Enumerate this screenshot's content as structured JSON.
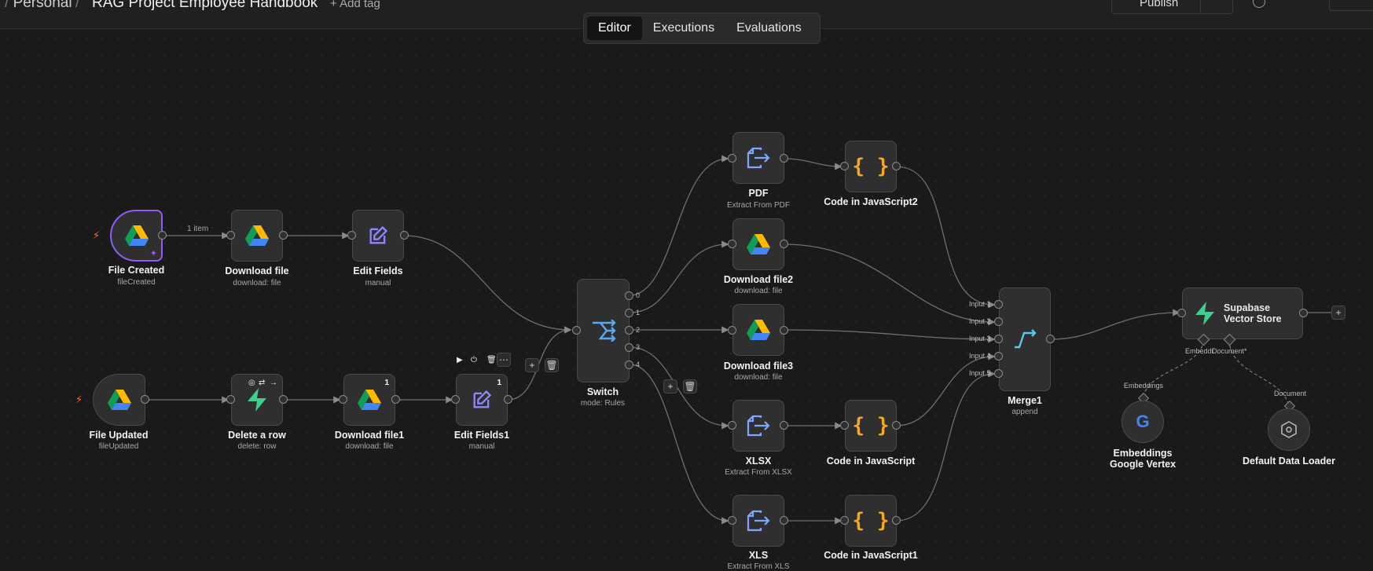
{
  "header": {
    "breadcrumb_personal": "Personal",
    "workflow_name": "RAG Project Employee Handbook",
    "add_tag": "+ Add tag",
    "publish": "Publish"
  },
  "tabs": [
    {
      "label": "Editor",
      "active": true
    },
    {
      "label": "Executions"
    },
    {
      "label": "Evaluations"
    }
  ],
  "edge_labels": {
    "item_count": "1 item"
  },
  "nodes": {
    "file_created": {
      "title": "File Created",
      "sub": "fileCreated",
      "icon": "google-drive-icon"
    },
    "download_file": {
      "title": "Download file",
      "sub": "download: file",
      "icon": "google-drive-icon"
    },
    "edit_fields": {
      "title": "Edit Fields",
      "sub": "manual",
      "icon": "pencil-icon"
    },
    "file_updated": {
      "title": "File Updated",
      "sub": "fileUpdated",
      "icon": "google-drive-icon"
    },
    "delete_row": {
      "title": "Delete a row",
      "sub": "delete: row",
      "icon": "supabase-icon"
    },
    "download_file1": {
      "title": "Download file1",
      "sub": "download: file",
      "icon": "google-drive-icon",
      "badge": "1"
    },
    "edit_fields1": {
      "title": "Edit Fields1",
      "sub": "manual",
      "icon": "pencil-icon",
      "badge": "1"
    },
    "switch": {
      "title": "Switch",
      "sub": "mode: Rules",
      "icon": "switch-icon",
      "outputs": [
        "0",
        "1",
        "2",
        "3",
        "4"
      ]
    },
    "pdf": {
      "title": "PDF",
      "sub": "Extract From PDF",
      "icon": "extract-icon"
    },
    "download_file2": {
      "title": "Download file2",
      "sub": "download: file",
      "icon": "google-drive-icon"
    },
    "download_file3": {
      "title": "Download file3",
      "sub": "download: file",
      "icon": "google-drive-icon"
    },
    "xlsx": {
      "title": "XLSX",
      "sub": "Extract From XLSX",
      "icon": "extract-icon"
    },
    "xls": {
      "title": "XLS",
      "sub": "Extract From XLS",
      "icon": "extract-icon"
    },
    "code2": {
      "title": "Code in JavaScript2",
      "icon": "code-braces-icon"
    },
    "code": {
      "title": "Code in JavaScript",
      "icon": "code-braces-icon"
    },
    "code1": {
      "title": "Code in JavaScript1",
      "icon": "code-braces-icon"
    },
    "merge1": {
      "title": "Merge1",
      "sub": "append",
      "icon": "merge-icon",
      "inputs": [
        "Input 1",
        "Input 2",
        "Input 3",
        "Input 4",
        "Input 5"
      ]
    },
    "supabase_store": {
      "title": "Supabase Vector Store",
      "icon": "supabase-icon",
      "ports": [
        "Embeddi",
        "Document*"
      ]
    },
    "embeddings": {
      "title": "Embeddings Google Vertex",
      "icon": "google-icon",
      "port_label": "Embeddings"
    },
    "loader": {
      "title": "Default Data Loader",
      "icon": "data-loader-icon",
      "port_label": "Document"
    }
  },
  "colors": {
    "accent": "#8b5cf6",
    "trigger": "#ff6d2d",
    "canvas": "#1a1a1a",
    "edge": "#6f6f6f"
  }
}
